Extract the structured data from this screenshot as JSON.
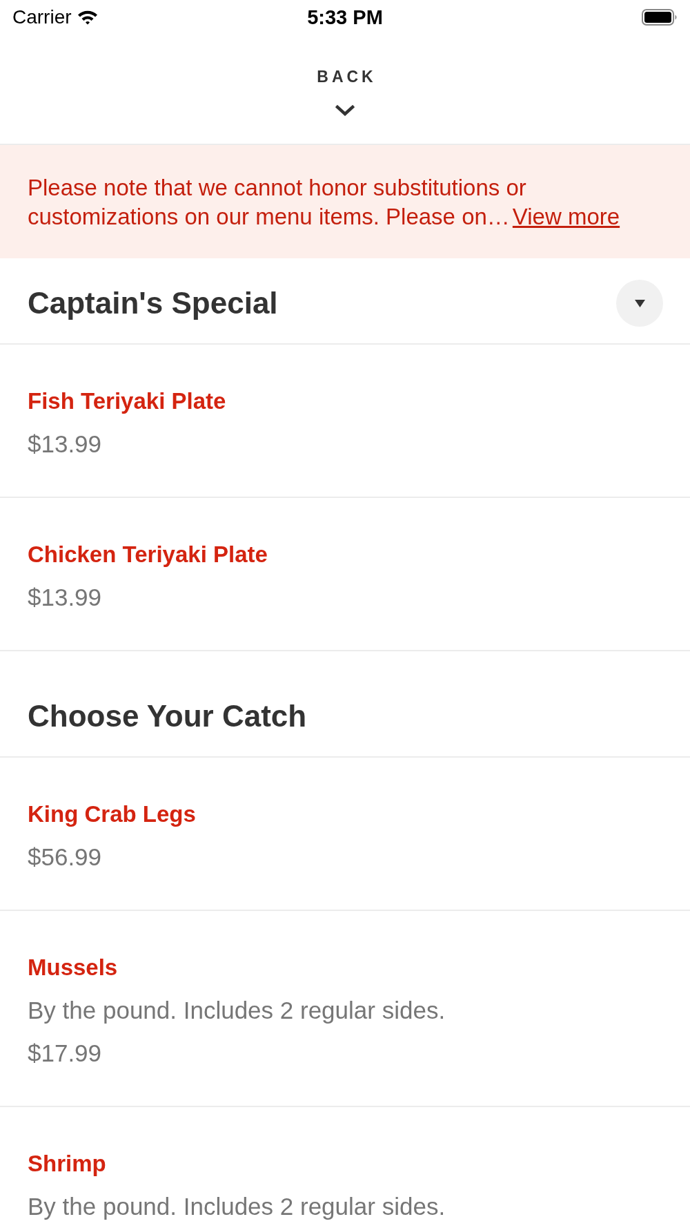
{
  "status_bar": {
    "carrier": "Carrier",
    "time": "5:33 PM"
  },
  "header": {
    "back_label": "BACK"
  },
  "notice": {
    "text": "Please note that we cannot honor substitutions or customizations on our menu items. Please on…",
    "link": "View more"
  },
  "sections": [
    {
      "title": "Captain's Special",
      "collapsible": true,
      "items": [
        {
          "name": "Fish Teriyaki Plate",
          "price": "$13.99"
        },
        {
          "name": "Chicken Teriyaki Plate",
          "price": "$13.99"
        }
      ]
    },
    {
      "title": "Choose Your Catch",
      "collapsible": false,
      "items": [
        {
          "name": "King Crab Legs",
          "price": "$56.99"
        },
        {
          "name": "Mussels",
          "description": "By the pound. Includes 2 regular sides.",
          "price": "$17.99"
        },
        {
          "name": "Shrimp",
          "description": "By the pound. Includes 2 regular sides."
        }
      ]
    }
  ]
}
